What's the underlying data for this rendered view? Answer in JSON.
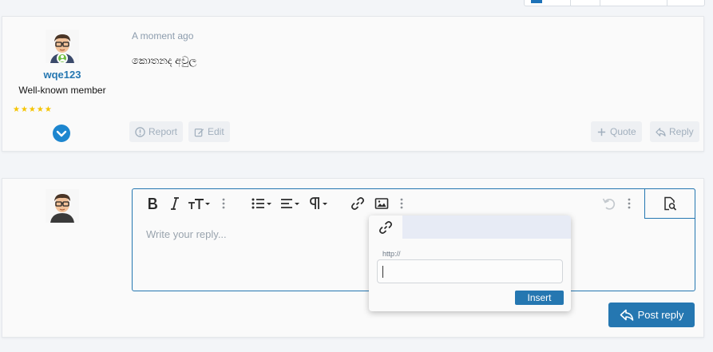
{
  "post": {
    "timestamp": "A moment ago",
    "message": "කොතනද අවුල",
    "author": {
      "username": "wqe123",
      "title": "Well-known member",
      "stars": "★★★★★"
    },
    "actions": {
      "report": "Report",
      "edit": "Edit",
      "quote": "Quote",
      "reply": "Reply"
    }
  },
  "reply_editor": {
    "placeholder": "Write your reply...",
    "link_popup": {
      "url_label": "http://",
      "url_value": "",
      "insert_label": "Insert"
    },
    "submit_label": "Post reply"
  },
  "colors": {
    "accent": "#2577b1",
    "online": "#6fbf40",
    "stars": "#f5c400"
  }
}
